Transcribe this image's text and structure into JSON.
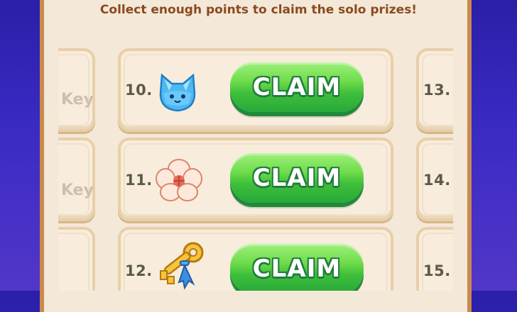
{
  "header": {
    "instruction": "Collect enough points to claim the solo prizes!"
  },
  "left_column": {
    "rows": [
      {
        "label_fragment": "Key"
      },
      {
        "label_fragment": "Key"
      },
      {
        "label_fragment": ""
      }
    ]
  },
  "center_column": {
    "rows": [
      {
        "number": "10.",
        "icon": "crystal-cat-icon",
        "button_label": "CLAIM"
      },
      {
        "number": "11.",
        "icon": "cotton-flower-icon",
        "button_label": "CLAIM"
      },
      {
        "number": "12.",
        "icon": "gold-key-icon",
        "button_label": "CLAIM"
      }
    ]
  },
  "right_column": {
    "rows": [
      {
        "number": "13."
      },
      {
        "number": "14."
      },
      {
        "number": "15."
      }
    ]
  },
  "colors": {
    "background": "#2a1fa8",
    "panel": "#f4e8d8",
    "panel_border": "#c98a4f",
    "instruction_text": "#8a4a1f",
    "claim_green": "#3fbf3a",
    "number_text": "#5b5a4a"
  }
}
